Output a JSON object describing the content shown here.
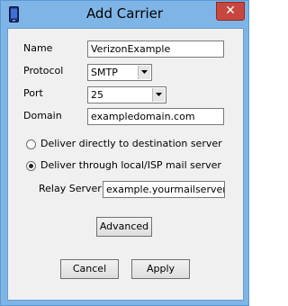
{
  "window": {
    "title": "Add Carrier",
    "close_glyph": "✕",
    "icon": "phone-icon"
  },
  "form": {
    "name_label": "Name",
    "name_value": "VerizonExample",
    "protocol_label": "Protocol",
    "protocol_value": "SMTP",
    "port_label": "Port",
    "port_value": "25",
    "domain_label": "Domain",
    "domain_value": "exampledomain.com",
    "radio_direct_label": "Deliver directly to destination server",
    "radio_direct_selected": false,
    "radio_relay_label": "Deliver through local/ISP mail server",
    "radio_relay_selected": true,
    "relay_label": "Relay Server",
    "relay_value": "example.yourmailserver.com"
  },
  "buttons": {
    "advanced": "Advanced",
    "cancel": "Cancel",
    "apply": "Apply"
  }
}
